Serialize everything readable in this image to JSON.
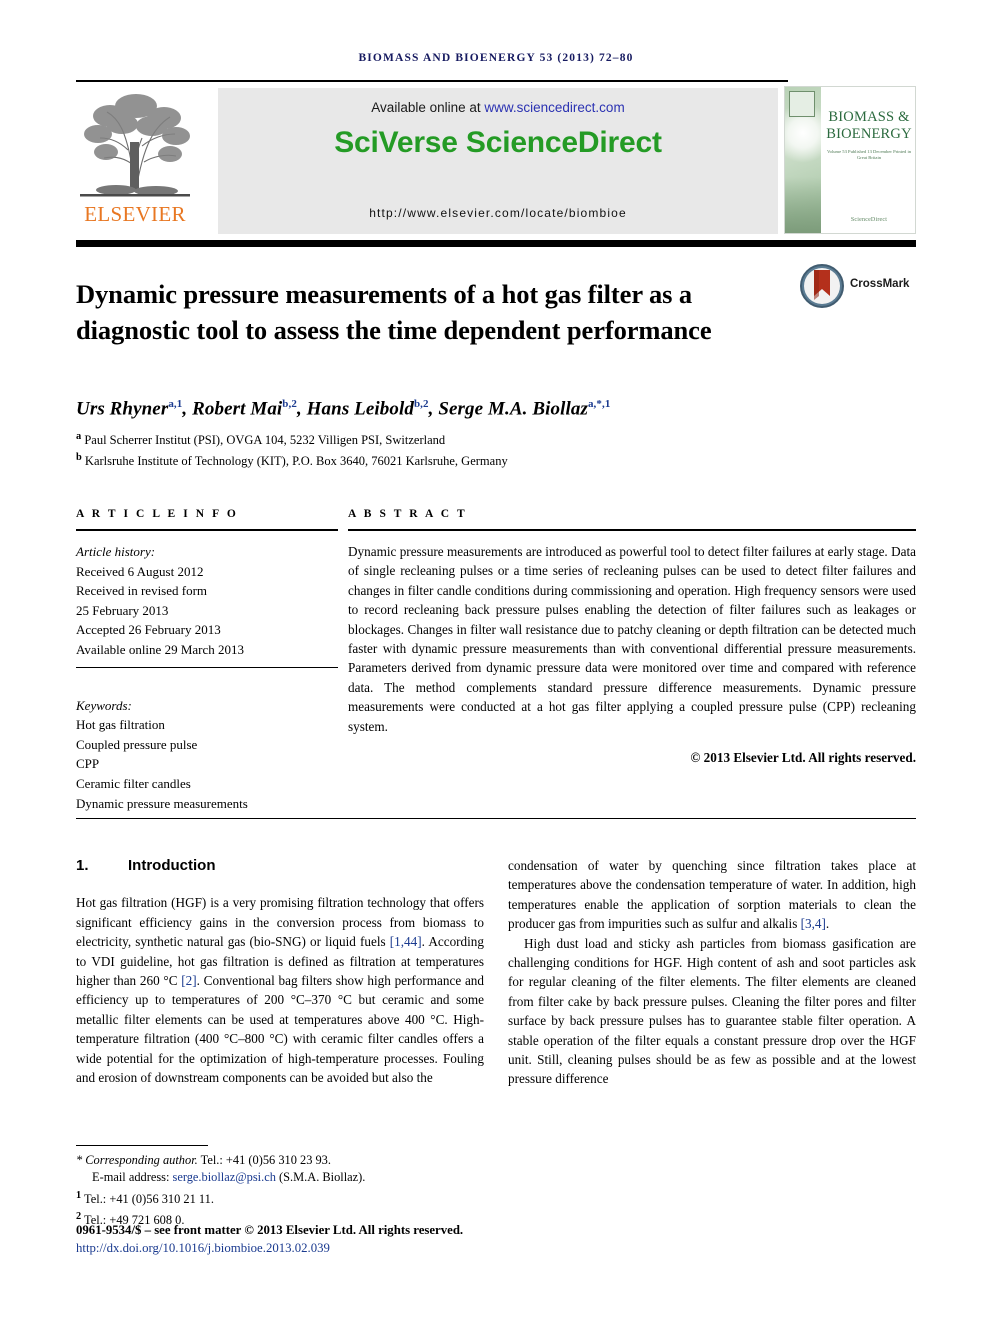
{
  "running_head": "BIOMASS AND BIOENERGY 53 (2013) 72–80",
  "masthead": {
    "publisher_name": "ELSEVIER",
    "available_prefix": "Available online at ",
    "available_url": "www.sciencedirect.com",
    "sciverse_logo": "SciVerse ScienceDirect",
    "locate_url": "http://www.elsevier.com/locate/biombioe",
    "cover": {
      "title_line1": "BIOMASS &",
      "title_line2": "BIOENERGY",
      "subtitle": "Volume 53  Published 13 December\nPrinted in Great Britain",
      "footer": "ScienceDirect"
    }
  },
  "article": {
    "title": "Dynamic pressure measurements of a hot gas filter as a diagnostic tool to assess the time dependent performance",
    "crossmark_label": "CrossMark",
    "authors_html": "Urs Rhyner<sup>a,1</sup>, Robert Mai<sup>b,2</sup>, Hans Leibold<sup>b,2</sup>, Serge M.A. Biollaz<sup>a,*,1</sup>",
    "affiliations": [
      "<sup>a</sup> Paul Scherrer Institut (PSI), OVGA 104, 5232 Villigen PSI, Switzerland",
      "<sup>b</sup> Karlsruhe Institute of Technology (KIT), P.O. Box 3640, 76021 Karlsruhe, Germany"
    ]
  },
  "article_info": {
    "heading": "A R T I C L E   I N F O",
    "history_label": "Article history:",
    "history": [
      "Received 6 August 2012",
      "Received in revised form",
      "25 February 2013",
      "Accepted 26 February 2013",
      "Available online 29 March 2013"
    ],
    "keywords_label": "Keywords:",
    "keywords": [
      "Hot gas filtration",
      "Coupled pressure pulse",
      "CPP",
      "Ceramic filter candles",
      "Dynamic pressure measurements"
    ]
  },
  "abstract": {
    "heading": "A B S T R A C T",
    "text": "Dynamic pressure measurements are introduced as powerful tool to detect filter failures at early stage. Data of single recleaning pulses or a time series of recleaning pulses can be used to detect filter failures and changes in filter candle conditions during commissioning and operation. High frequency sensors were used to record recleaning back pressure pulses enabling the detection of filter failures such as leakages or blockages. Changes in filter wall resistance due to patchy cleaning or depth filtration can be detected much faster with dynamic pressure measurements than with conventional differential pressure measurements. Parameters derived from dynamic pressure data were monitored over time and compared with reference data. The method complements standard pressure difference measurements. Dynamic pressure measurements were conducted at a hot gas filter applying a coupled pressure pulse (CPP) recleaning system.",
    "copyright": "© 2013 Elsevier Ltd. All rights reserved."
  },
  "body": {
    "section_number": "1.",
    "section_title": "Introduction",
    "left_paragraph_html": "Hot gas filtration (HGF) is a very promising filtration technology that offers significant efficiency gains in the conversion process from biomass to electricity, synthetic natural gas (bio-SNG) or liquid fuels <span class=\"ref\">[1,44]</span>. According to VDI guideline, hot gas filtration is defined as filtration at temperatures higher than 260 °C <span class=\"ref\">[2]</span>. Conventional bag filters show high performance and efficiency up to temperatures of 200 °C–370 °C but ceramic and some metallic filter elements can be used at temperatures above 400 °C. High-temperature filtration (400 °C–800 °C) with ceramic filter candles offers a wide potential for the optimization of high-temperature processes. Fouling and erosion of downstream components can be avoided but also the",
    "right_paragraph1_html": "condensation of water by quenching since filtration takes place at temperatures above the condensation temperature of water. In addition, high temperatures enable the application of sorption materials to clean the producer gas from impurities such as sulfur and alkalis <span class=\"ref\">[3,4]</span>.",
    "right_paragraph2_html": "High dust load and sticky ash particles from biomass gasification are challenging conditions for HGF. High content of ash and soot particles ask for regular cleaning of the filter elements. The filter elements are cleaned from filter cake by back pressure pulses. Cleaning the filter pores and filter surface by back pressure pulses has to guarantee stable filter operation. A stable operation of the filter equals a constant pressure drop over the HGF unit. Still, cleaning pulses should be as few as possible and at the lowest pressure difference"
  },
  "footnotes": {
    "corresponding_html": "<span class=\"ital\">* Corresponding author.</span> Tel.: +41 (0)56 310 23 93.",
    "email_label": "E-mail address: ",
    "email": "serge.biollaz@psi.ch",
    "email_suffix": " (S.M.A. Biollaz).",
    "note1_html": "<sup>1</sup> Tel.: +41 (0)56 310 21 11.",
    "note2_html": "<sup>2</sup> Tel.: +49 721 608 0.",
    "issn_line": "0961-9534/$ – see front matter © 2013 Elsevier Ltd. All rights reserved.",
    "doi": "http://dx.doi.org/10.1016/j.biombioe.2013.02.039"
  },
  "colors": {
    "running_head": "#161a60",
    "elsevier_orange": "#e87722",
    "sciencedirect_green": "#249b25",
    "link_blue": "#1a3a8f"
  }
}
